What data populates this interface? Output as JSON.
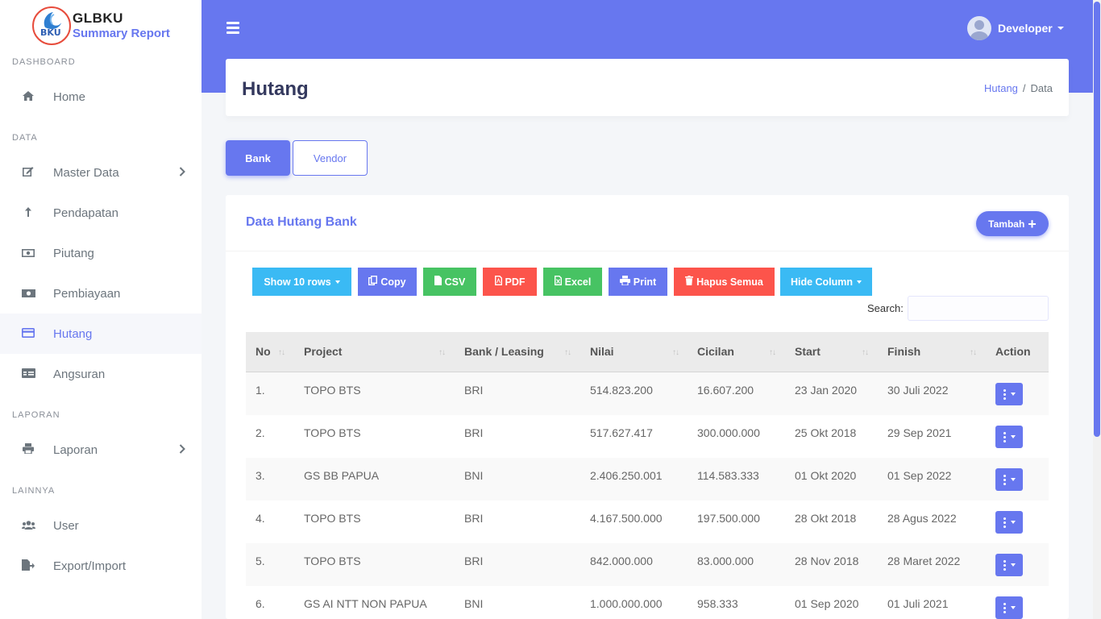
{
  "brand": {
    "title": "GLBKU",
    "subtitle": "Summary Report",
    "logo_text": "BKU"
  },
  "sidebar": {
    "sections": [
      {
        "header": "DASHBOARD",
        "items": [
          {
            "label": "Home",
            "icon": "home-icon"
          }
        ]
      },
      {
        "header": "DATA",
        "items": [
          {
            "label": "Master Data",
            "icon": "edit-icon",
            "has_submenu": true
          },
          {
            "label": "Pendapatan",
            "icon": "arrow-up-icon"
          },
          {
            "label": "Piutang",
            "icon": "money-bill-icon"
          },
          {
            "label": "Pembiayaan",
            "icon": "money-icon"
          },
          {
            "label": "Hutang",
            "icon": "credit-card-icon",
            "active": true
          },
          {
            "label": "Angsuran",
            "icon": "id-card-icon"
          }
        ]
      },
      {
        "header": "LAPORAN",
        "items": [
          {
            "label": "Laporan",
            "icon": "print-icon",
            "has_submenu": true
          }
        ]
      },
      {
        "header": "LAINNYA",
        "items": [
          {
            "label": "User",
            "icon": "users-icon"
          },
          {
            "label": "Export/Import",
            "icon": "file-export-icon"
          }
        ]
      }
    ]
  },
  "topbar": {
    "user_name": "Developer"
  },
  "page": {
    "title": "Hutang",
    "breadcrumb": [
      "Hutang",
      "Data"
    ]
  },
  "tabs": [
    {
      "label": "Bank",
      "active": true
    },
    {
      "label": "Vendor",
      "active": false
    }
  ],
  "card": {
    "title": "Data Hutang Bank",
    "add_button": "Tambah",
    "toolbar": {
      "show_rows": "Show 10 rows",
      "copy": "Copy",
      "csv": "CSV",
      "pdf": "PDF",
      "excel": "Excel",
      "print": "Print",
      "delete_all": "Hapus Semua",
      "hide_column": "Hide Column"
    },
    "search_label": "Search:",
    "search_value": ""
  },
  "table": {
    "columns": [
      "No",
      "Project",
      "Bank / Leasing",
      "Nilai",
      "Cicilan",
      "Start",
      "Finish",
      "Action"
    ],
    "rows": [
      {
        "no": "1.",
        "project": "TOPO BTS",
        "bank": "BRI",
        "nilai": "514.823.200",
        "cicilan": "16.607.200",
        "start": "23 Jan 2020",
        "finish": "30 Juli 2022"
      },
      {
        "no": "2.",
        "project": "TOPO BTS",
        "bank": "BRI",
        "nilai": "517.627.417",
        "cicilan": "300.000.000",
        "start": "25 Okt 2018",
        "finish": "29 Sep 2021"
      },
      {
        "no": "3.",
        "project": "GS BB PAPUA",
        "bank": "BNI",
        "nilai": "2.406.250.001",
        "cicilan": "114.583.333",
        "start": "01 Okt 2020",
        "finish": "01 Sep 2022"
      },
      {
        "no": "4.",
        "project": "TOPO BTS",
        "bank": "BRI",
        "nilai": "4.167.500.000",
        "cicilan": "197.500.000",
        "start": "28 Okt 2018",
        "finish": "28 Agus 2022"
      },
      {
        "no": "5.",
        "project": "TOPO BTS",
        "bank": "BRI",
        "nilai": "842.000.000",
        "cicilan": "83.000.000",
        "start": "28 Nov 2018",
        "finish": "28 Maret 2022"
      },
      {
        "no": "6.",
        "project": "GS AI NTT NON PAPUA",
        "bank": "BNI",
        "nilai": "1.000.000.000",
        "cicilan": "958.333",
        "start": "01 Sep 2020",
        "finish": "01 Juli 2021"
      }
    ]
  },
  "colors": {
    "primary": "#6777ef",
    "info": "#3abaf4",
    "success": "#47c363",
    "danger": "#fc544b",
    "sidebar_bg": "#ffffff",
    "page_bg": "#f4f6f9"
  }
}
